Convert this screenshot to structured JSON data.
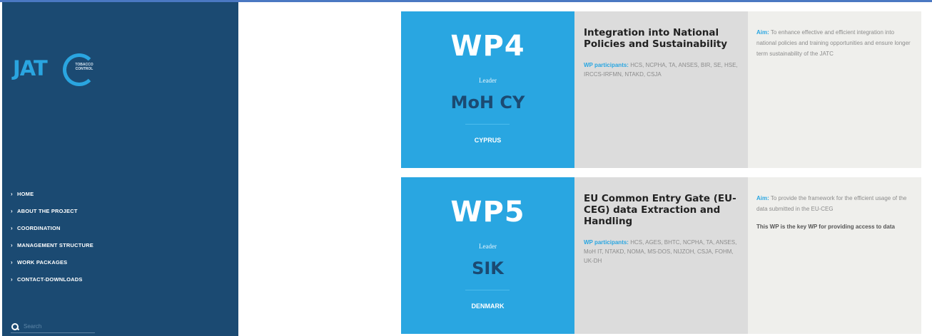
{
  "logo": {
    "text": "JAT",
    "subtitle": "TOBACCO CONTROL"
  },
  "nav": {
    "caret": "›",
    "items": [
      {
        "label": "HOME"
      },
      {
        "label": "ABOUT THE PROJECT"
      },
      {
        "label": "COORDINATION"
      },
      {
        "label": "MANAGEMENT STRUCTURE"
      },
      {
        "label": "WORK PACKAGES"
      },
      {
        "label": "CONTACT-DOWNLOADS"
      }
    ]
  },
  "search": {
    "placeholder": "Search",
    "icon": "search-icon"
  },
  "work_packages": [
    {
      "code": "WP4",
      "leader_label": "Leader",
      "leader": "MoH CY",
      "country": "CYPRUS",
      "title": "Integration into National Policies and Sustainability",
      "participants_label": "WP participants:",
      "participants": "HCS, NCPHA, TA, ANSES, BIR, SE, HSE, IRCCS-IRFMN, NTAKD, CSJA",
      "aim_label": "Aim:",
      "aim": "To enhance effective and efficient integration into national policies and training opportunities and ensure longer term sustainability of the JATC",
      "note": ""
    },
    {
      "code": "WP5",
      "leader_label": "Leader",
      "leader": "SIK",
      "country": "DENMARK",
      "title": "EU Common Entry Gate (EU-CEG) data Extraction and Handling",
      "participants_label": "WP participants:",
      "participants": "HCS, AGES, BHTC, NCPHA, TA, ANSES, MoH IT, NTAKD, NOMA, MS-DOS, NIJZOH, CSJA, FOHM, UK-DH",
      "aim_label": "Aim:",
      "aim": "To provide the framework for the efficient usage of the data submitted in the EU-CEG",
      "note": "This WP is the key WP for providing access to data"
    }
  ],
  "colors": {
    "sidebar": "#1b4a72",
    "accent": "#29a6e1",
    "title_panel": "#dcdcdc",
    "aim_panel": "#efefec"
  }
}
